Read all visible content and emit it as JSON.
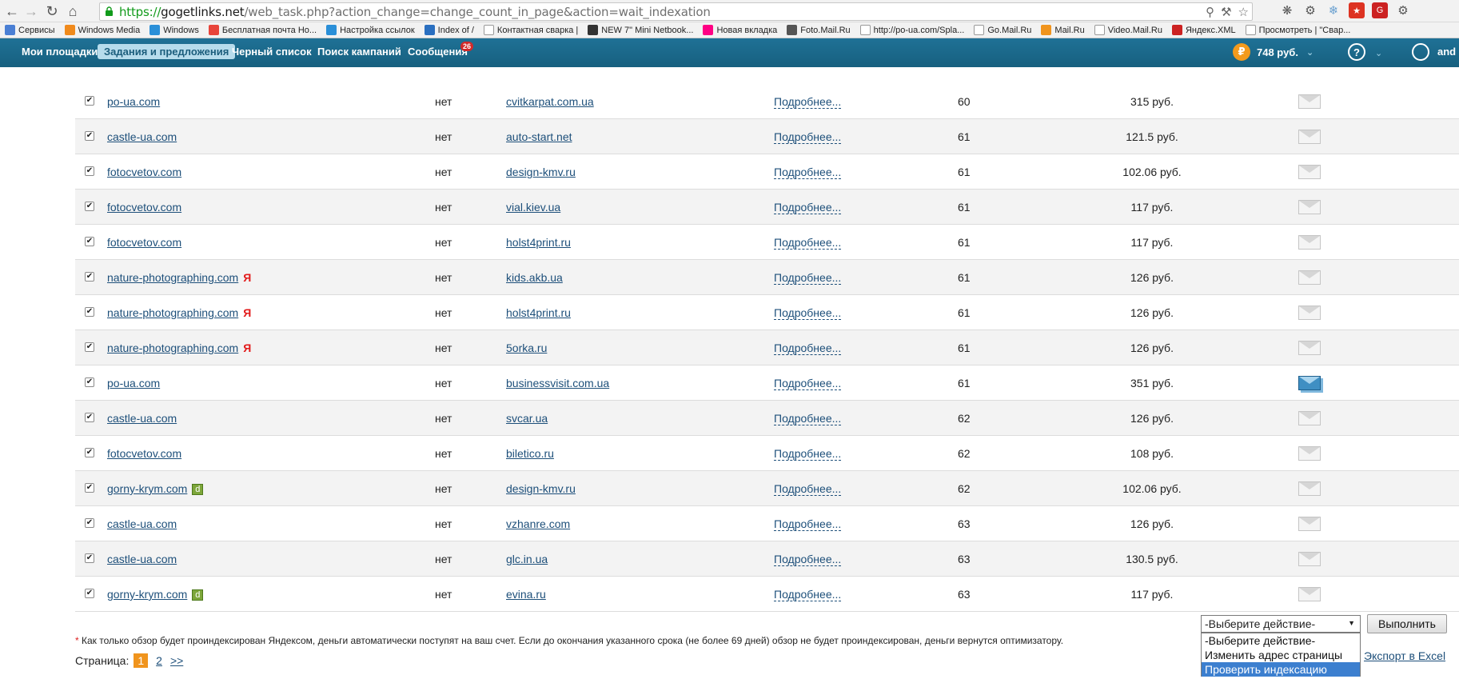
{
  "browser": {
    "url_proto": "https://",
    "url_host": "gogetlinks.net",
    "url_rest": "/web_task.php?action_change=change_count_in_page&action=wait_indexation",
    "bookmarks": [
      {
        "label": "Сервисы",
        "icon": "apps-icon"
      },
      {
        "label": "Windows Media",
        "icon": "windows-media-icon"
      },
      {
        "label": "Windows",
        "icon": "windows-icon"
      },
      {
        "label": "Бесплатная почта Но...",
        "icon": "mail-icon"
      },
      {
        "label": "Настройка ссылок",
        "icon": "windows-icon"
      },
      {
        "label": "Index of /",
        "icon": "index-icon"
      },
      {
        "label": "Контактная сварка |",
        "icon": "page-icon"
      },
      {
        "label": "NEW 7\" Mini Netbook...",
        "icon": "shop-icon"
      },
      {
        "label": "Новая вкладка",
        "icon": "flickr-icon"
      },
      {
        "label": "Foto.Mail.Ru",
        "icon": "camera-icon"
      },
      {
        "label": "http://po-ua.com/Spla...",
        "icon": "page-icon"
      },
      {
        "label": "Go.Mail.Ru",
        "icon": "page-icon"
      },
      {
        "label": "Mail.Ru",
        "icon": "mailru-icon"
      },
      {
        "label": "Video.Mail.Ru",
        "icon": "page-icon"
      },
      {
        "label": "Яндекс.XML",
        "icon": "xml-icon"
      },
      {
        "label": "Просмотреть | \"Свар...",
        "icon": "page-icon"
      }
    ]
  },
  "nav": {
    "items": [
      "Мои площадки",
      "Задания и предложения",
      "Черный список",
      "Поиск кампаний",
      "Сообщения"
    ],
    "messages_badge": "26",
    "balance": "748 руб.",
    "rub_symbol": "₽",
    "help_symbol": "?",
    "user": "and"
  },
  "table": {
    "rows": [
      {
        "site": "po-ua.com",
        "tag": "",
        "status": "нет",
        "target": "cvitkarpat.com.ua",
        "more": "Подробнее...",
        "count": "60",
        "price": "315 руб.",
        "mail_active": false
      },
      {
        "site": "castle-ua.com",
        "tag": "",
        "status": "нет",
        "target": "auto-start.net",
        "more": "Подробнее...",
        "count": "61",
        "price": "121.5 руб.",
        "mail_active": false
      },
      {
        "site": "fotocvetov.com",
        "tag": "",
        "status": "нет",
        "target": "design-kmv.ru",
        "more": "Подробнее...",
        "count": "61",
        "price": "102.06 руб.",
        "mail_active": false
      },
      {
        "site": "fotocvetov.com",
        "tag": "",
        "status": "нет",
        "target": "vial.kiev.ua",
        "more": "Подробнее...",
        "count": "61",
        "price": "117 руб.",
        "mail_active": false
      },
      {
        "site": "fotocvetov.com",
        "tag": "",
        "status": "нет",
        "target": "holst4print.ru",
        "more": "Подробнее...",
        "count": "61",
        "price": "117 руб.",
        "mail_active": false
      },
      {
        "site": "nature-photographing.com",
        "tag": "Я",
        "status": "нет",
        "target": "kids.akb.ua",
        "more": "Подробнее...",
        "count": "61",
        "price": "126 руб.",
        "mail_active": false
      },
      {
        "site": "nature-photographing.com",
        "tag": "Я",
        "status": "нет",
        "target": "holst4print.ru",
        "more": "Подробнее...",
        "count": "61",
        "price": "126 руб.",
        "mail_active": false
      },
      {
        "site": "nature-photographing.com",
        "tag": "Я",
        "status": "нет",
        "target": "5orka.ru",
        "more": "Подробнее...",
        "count": "61",
        "price": "126 руб.",
        "mail_active": false
      },
      {
        "site": "po-ua.com",
        "tag": "",
        "status": "нет",
        "target": "businessvisit.com.ua",
        "more": "Подробнее...",
        "count": "61",
        "price": "351 руб.",
        "mail_active": true
      },
      {
        "site": "castle-ua.com",
        "tag": "",
        "status": "нет",
        "target": "svcar.ua",
        "more": "Подробнее...",
        "count": "62",
        "price": "126 руб.",
        "mail_active": false
      },
      {
        "site": "fotocvetov.com",
        "tag": "",
        "status": "нет",
        "target": "biletico.ru",
        "more": "Подробнее...",
        "count": "62",
        "price": "108 руб.",
        "mail_active": false
      },
      {
        "site": "gorny-krym.com",
        "tag": "d",
        "status": "нет",
        "target": "design-kmv.ru",
        "more": "Подробнее...",
        "count": "62",
        "price": "102.06 руб.",
        "mail_active": false
      },
      {
        "site": "castle-ua.com",
        "tag": "",
        "status": "нет",
        "target": "vzhanre.com",
        "more": "Подробнее...",
        "count": "63",
        "price": "126 руб.",
        "mail_active": false
      },
      {
        "site": "castle-ua.com",
        "tag": "",
        "status": "нет",
        "target": "glc.in.ua",
        "more": "Подробнее...",
        "count": "63",
        "price": "130.5 руб.",
        "mail_active": false
      },
      {
        "site": "gorny-krym.com",
        "tag": "d",
        "status": "нет",
        "target": "evina.ru",
        "more": "Подробнее...",
        "count": "63",
        "price": "117 руб.",
        "mail_active": false
      }
    ]
  },
  "footer": {
    "note_star": "*",
    "note": "Как только обзор будет проиндексирован Яндексом, деньги автоматически поступят на ваш счет. Если до окончания указанного срока (не более 69 дней) обзор не будет проиндексирован, деньги вернутся оптимизатору.",
    "page_label": "Страница:",
    "current_page": "1",
    "page_2": "2",
    "next": ">>",
    "select_value": "-Выберите действие-",
    "options": [
      "-Выберите действие-",
      "Изменить адрес страницы",
      "Проверить индексацию"
    ],
    "selected_option_index": 2,
    "execute_button": "Выполнить",
    "export_link": "Экспорт в Excel"
  }
}
